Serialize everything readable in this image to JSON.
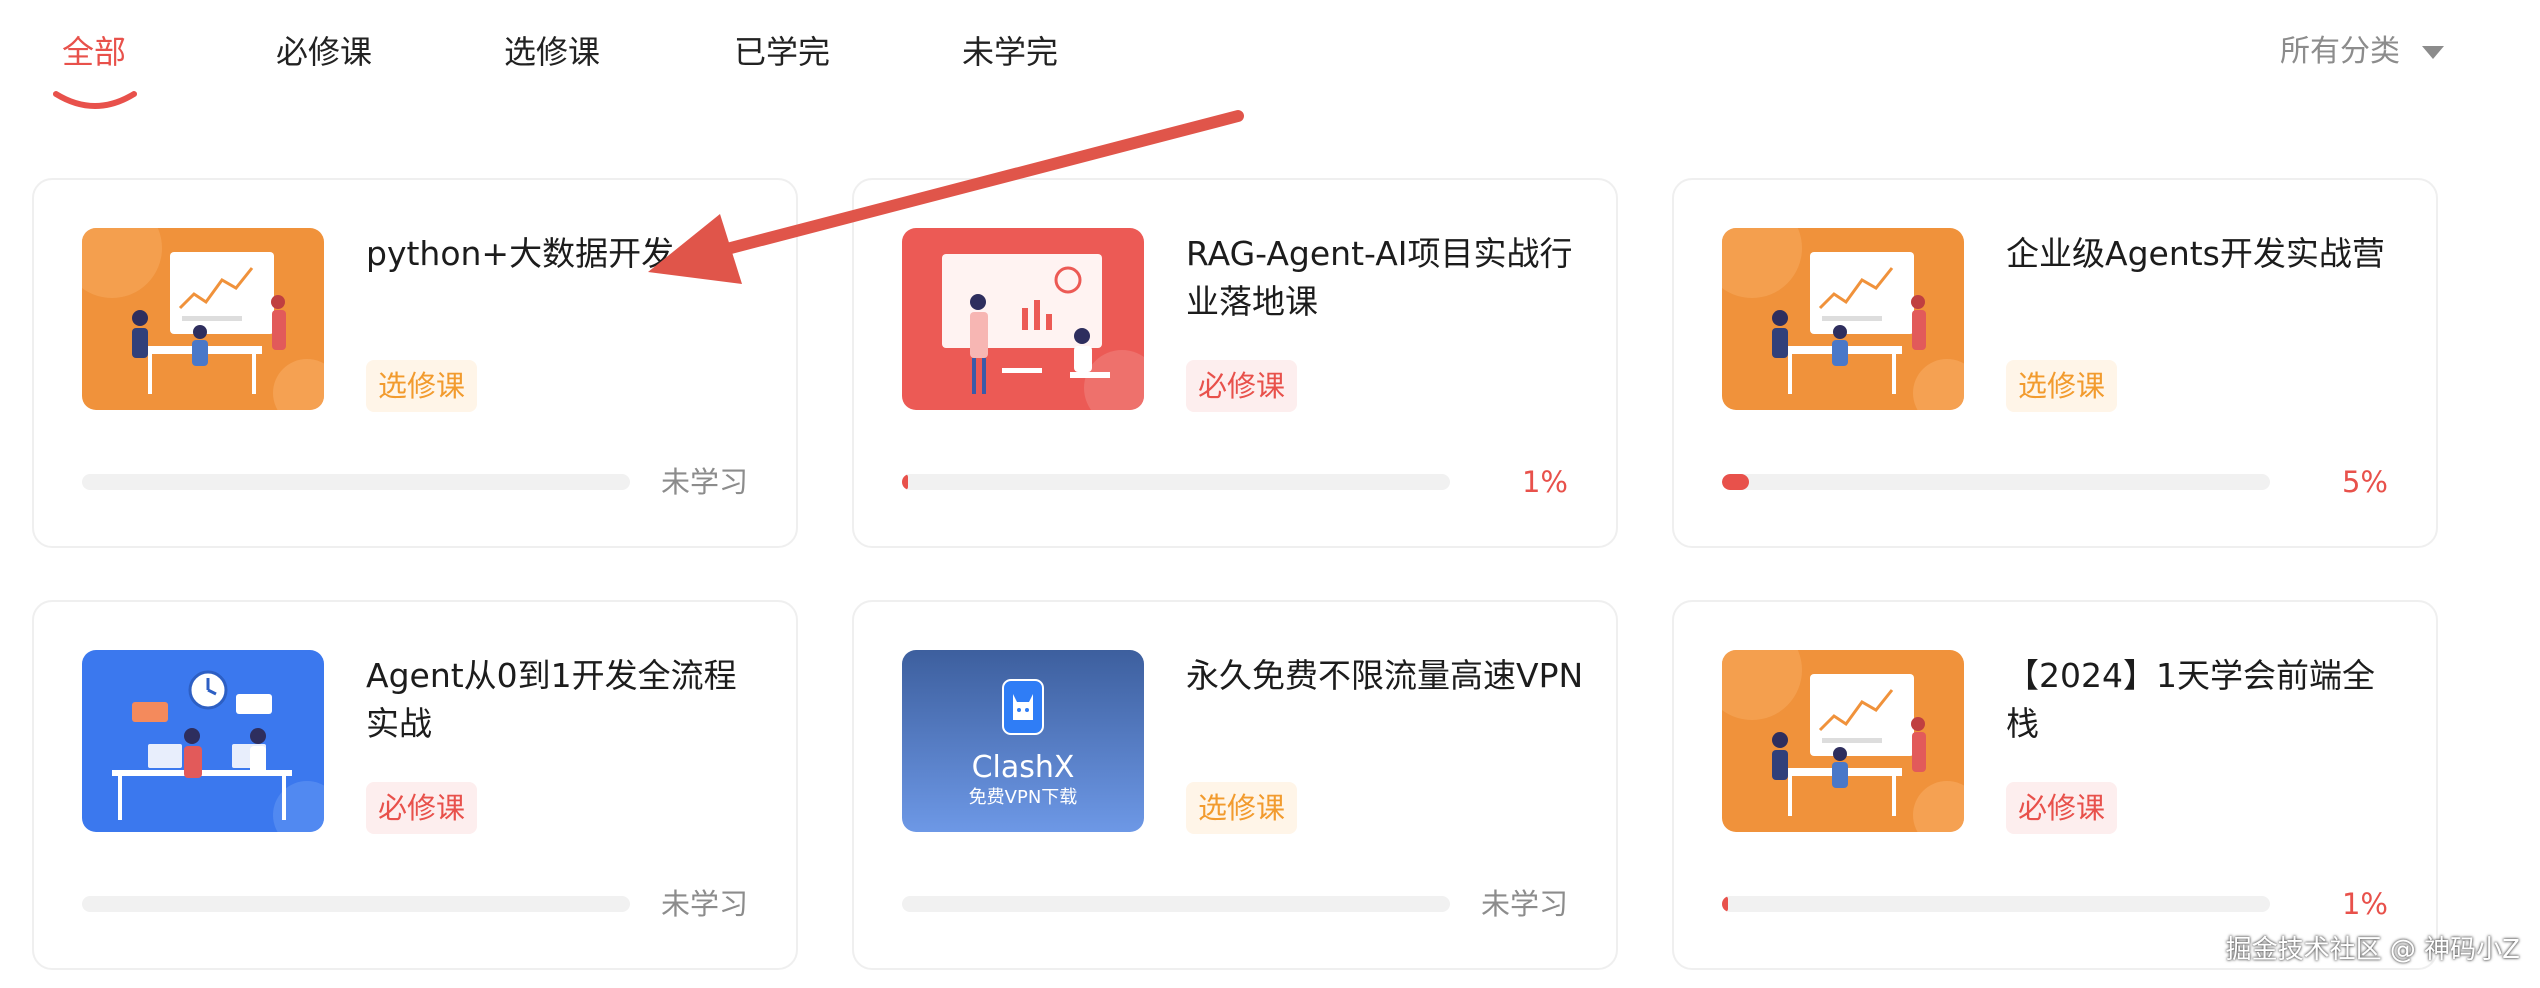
{
  "tabs": [
    {
      "label": "全部",
      "active": true
    },
    {
      "label": "必修课",
      "active": false
    },
    {
      "label": "选修课",
      "active": false
    },
    {
      "label": "已学完",
      "active": false
    },
    {
      "label": "未学完",
      "active": false
    }
  ],
  "filter": {
    "label": "所有分类"
  },
  "colors": {
    "accent": "#e8514b",
    "elective": "#f29b2e",
    "muted": "#8c8c8c"
  },
  "courses": [
    {
      "title": "python+大数据开发",
      "tag": "选修课",
      "tag_type": "elective",
      "status_text": "未学习",
      "progress": 0,
      "thumb": "orange-meeting"
    },
    {
      "title": "RAG-Agent-AI项目实战行业落地课",
      "tag": "必修课",
      "tag_type": "required",
      "status_text": "1%",
      "progress": 0.01,
      "thumb": "red-presentation"
    },
    {
      "title": "企业级Agents开发实战营",
      "tag": "选修课",
      "tag_type": "elective",
      "status_text": "5%",
      "progress": 0.05,
      "thumb": "orange-meeting"
    },
    {
      "title": "Agent从0到1开发全流程实战",
      "tag": "必修课",
      "tag_type": "required",
      "status_text": "未学习",
      "progress": 0,
      "thumb": "blue-office"
    },
    {
      "title": "永久免费不限流量高速VPN",
      "tag": "选修课",
      "tag_type": "elective",
      "status_text": "未学习",
      "progress": 0,
      "thumb": "clashx"
    },
    {
      "title": "【2024】1天学会前端全栈",
      "tag": "必修课",
      "tag_type": "required",
      "status_text": "1%",
      "progress": 0.01,
      "thumb": "orange-meeting"
    }
  ],
  "clashx": {
    "name": "ClashX",
    "subtitle": "免费VPN下载"
  },
  "watermark": "掘金技术社区 @ 神码小Z"
}
